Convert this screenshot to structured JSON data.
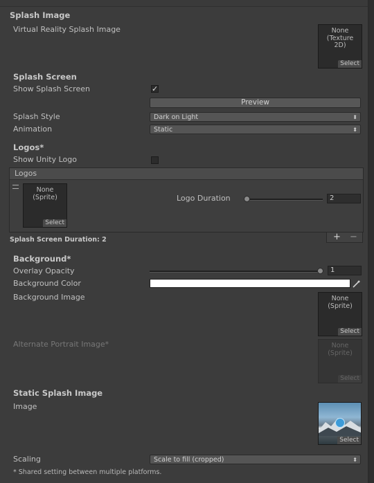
{
  "sections": {
    "splash_image": "Splash Image",
    "splash_screen": "Splash Screen",
    "logos": "Logos*",
    "background": "Background*",
    "static_splash": "Static Splash Image"
  },
  "vr_splash": {
    "label": "Virtual Reality Splash Image",
    "field_text": "None (Texture 2D)",
    "select": "Select"
  },
  "splash_screen": {
    "show_label": "Show Splash Screen",
    "show_checked": true,
    "preview_button": "Preview",
    "style_label": "Splash Style",
    "style_value": "Dark on Light",
    "animation_label": "Animation",
    "animation_value": "Static"
  },
  "logos": {
    "show_unity_label": "Show Unity Logo",
    "show_unity_checked": false,
    "list_header": "Logos",
    "item_field": "None (Sprite)",
    "item_select": "Select",
    "duration_label": "Logo Duration",
    "duration_value": "2",
    "add": "+",
    "remove": "−",
    "total_duration": "Splash Screen Duration: 2"
  },
  "background": {
    "overlay_label": "Overlay Opacity",
    "overlay_value": "1",
    "color_label": "Background Color",
    "color_value": "#ffffff",
    "image_label": "Background Image",
    "image_field": "None (Sprite)",
    "image_select": "Select",
    "alt_label": "Alternate Portrait Image*",
    "alt_field": "None (Sprite)",
    "alt_select": "Select"
  },
  "static_splash": {
    "image_label": "Image",
    "image_select": "Select",
    "scaling_label": "Scaling",
    "scaling_value": "Scale to fill (cropped)"
  },
  "footnote": "* Shared setting between multiple platforms.",
  "icons": {
    "checkmark": "check-icon",
    "dropdown_arrows": "updown-arrows-icon",
    "drag_handle": "drag-handle-icon",
    "eyedropper": "eyedropper-icon"
  }
}
